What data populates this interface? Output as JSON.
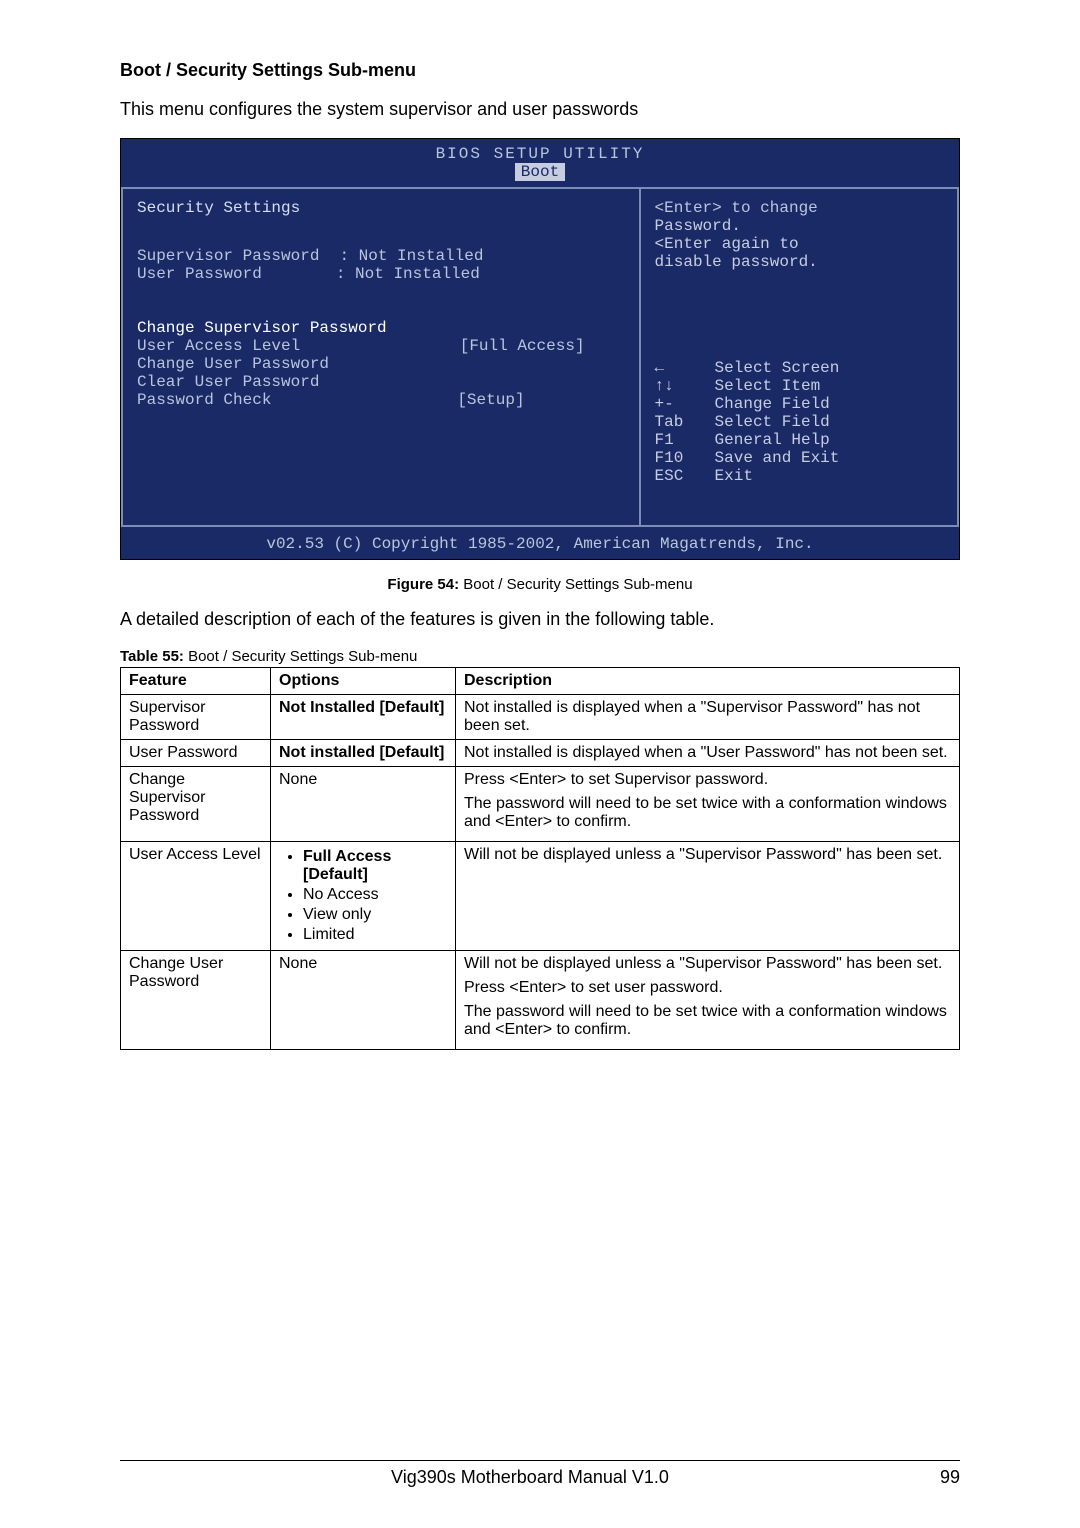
{
  "section_title": "Boot / Security Settings Sub-menu",
  "intro_text": "This menu configures the system supervisor and user passwords",
  "bios": {
    "header_title": "BIOS SETUP UTILITY",
    "tab": "Boot",
    "sec_title": "Security Settings",
    "supervisor_label": "Supervisor Password",
    "supervisor_value": ": Not Installed",
    "user_label": "User Password",
    "user_value": ": Not Installed",
    "change_supervisor": "Change Supervisor Password",
    "user_access_label": "User Access Level",
    "user_access_value": "[Full Access]",
    "change_user": "Change User Password",
    "clear_user": "Clear User Password",
    "password_check_label": "Password Check",
    "password_check_value": "[Setup]",
    "help1": "<Enter> to change",
    "help2": "Password.",
    "help3": "<Enter again to",
    "help4": "disable password.",
    "nav": [
      {
        "key": "←",
        "label": "Select Screen"
      },
      {
        "key": "↑↓",
        "label": "Select Item"
      },
      {
        "key": "+-",
        "label": "Change Field"
      },
      {
        "key": "Tab",
        "label": "Select Field"
      },
      {
        "key": "F1",
        "label": "General Help"
      },
      {
        "key": "F10",
        "label": "Save and Exit"
      },
      {
        "key": "ESC",
        "label": "Exit"
      }
    ],
    "footer": "v02.53 (C) Copyright 1985-2002, American Magatrends, Inc."
  },
  "figure_caption_label": "Figure 54:",
  "figure_caption_text": " Boot / Security Settings Sub-menu",
  "desc_text": "A detailed description of each of the features is given in the following table.",
  "table_caption_label": "Table 55:",
  "table_caption_text": " Boot / Security Settings Sub-menu",
  "table": {
    "headers": {
      "feature": "Feature",
      "options": "Options",
      "description": "Description"
    },
    "rows": {
      "r1": {
        "feature": "Supervisor Password",
        "opt_bold": "Not Installed [Default]",
        "desc": "Not installed is displayed when a \"Supervisor Password\" has not been set."
      },
      "r2": {
        "feature": "User Password",
        "opt_bold": "Not installed [Default]",
        "desc": "Not installed is displayed when a \"User Password\" has not been set."
      },
      "r3": {
        "feature": "Change Supervisor Password",
        "opt": "None",
        "desc1": "Press <Enter> to set Supervisor password.",
        "desc2": "The password will need to be set twice with a conformation windows and <Enter> to confirm."
      },
      "r4": {
        "feature": "User Access Level",
        "opt1_bold": "Full Access [Default]",
        "opt2": "No Access",
        "opt3": "View only",
        "opt4": "Limited",
        "desc": "Will not be displayed unless a \"Supervisor Password\" has been set."
      },
      "r5": {
        "feature": "Change User Password",
        "opt": "None",
        "desc1": "Will not be displayed unless a \"Supervisor Password\" has been set.",
        "desc2": "Press <Enter> to set user password.",
        "desc3": "The password will need to be set twice with a conformation windows and <Enter> to confirm."
      }
    }
  },
  "footer_center": "Vig390s Motherboard Manual V1.0",
  "footer_page": "99"
}
